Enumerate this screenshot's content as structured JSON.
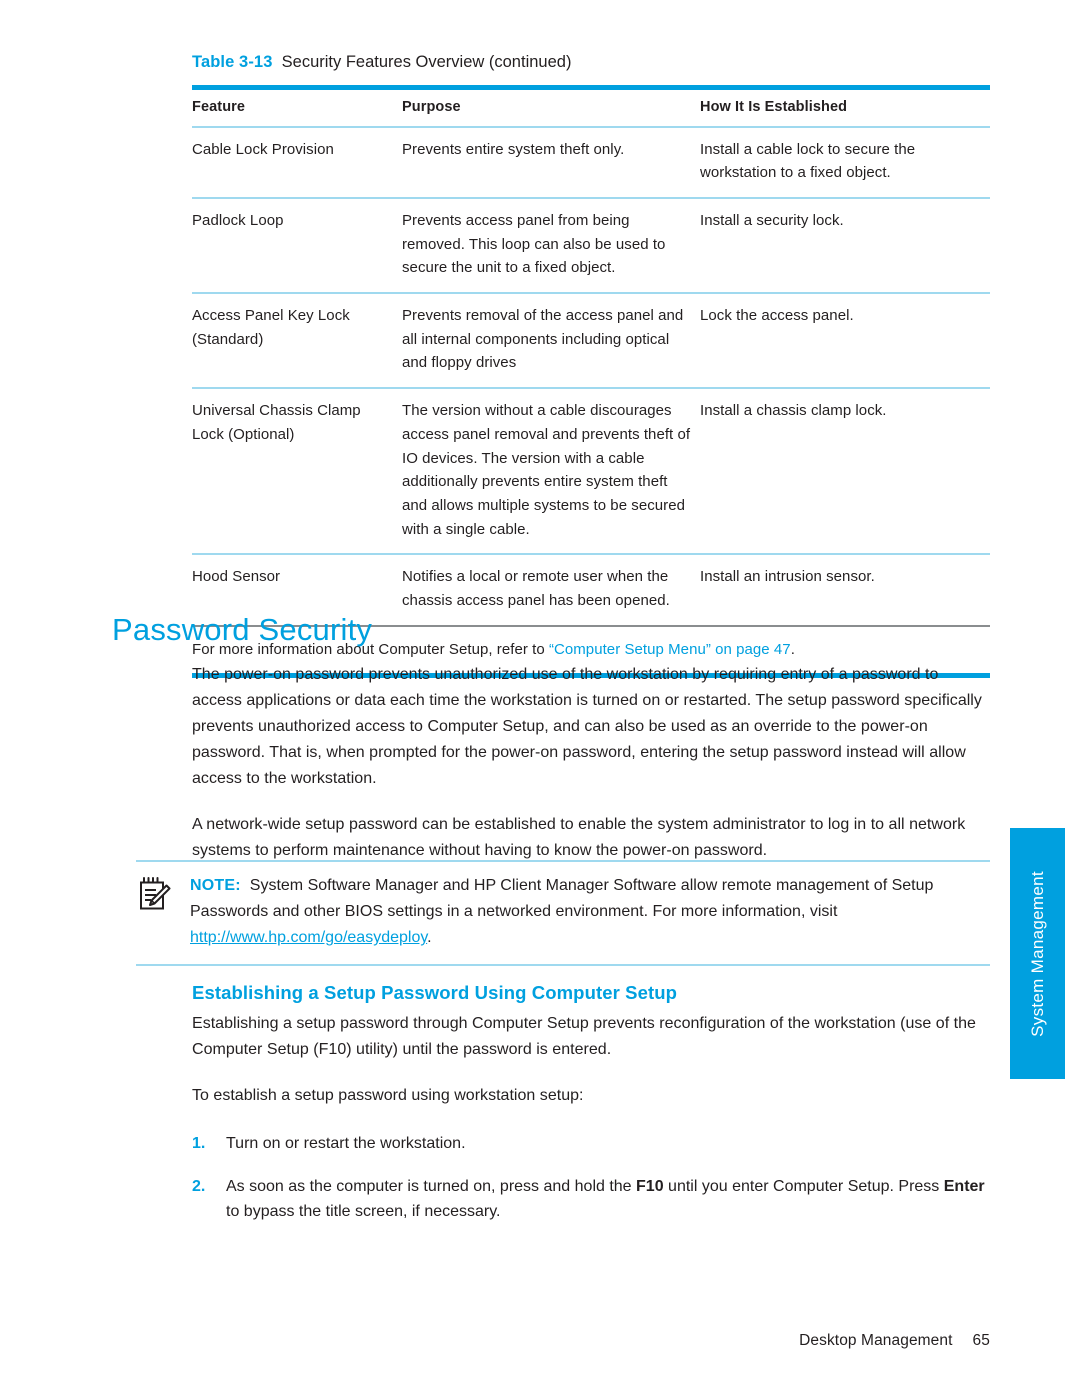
{
  "table": {
    "caption_number": "Table 3-13",
    "caption_text": "Security Features Overview (continued)",
    "headers": [
      "Feature",
      "Purpose",
      "How It Is Established"
    ],
    "rows": [
      {
        "feature": "Cable Lock Provision",
        "purpose": "Prevents entire system theft only.",
        "established": "Install a cable lock to secure the workstation to a fixed object."
      },
      {
        "feature": "Padlock Loop",
        "purpose": "Prevents access panel from being removed. This loop can also be used to secure the unit to a fixed object.",
        "established": "Install a security lock."
      },
      {
        "feature": "Access Panel Key Lock (Standard)",
        "purpose": "Prevents removal of the access panel and all internal components including optical and floppy drives",
        "established": "Lock the access panel."
      },
      {
        "feature": "Universal Chassis Clamp Lock (Optional)",
        "purpose": "The version without a cable discourages access panel removal and prevents theft of IO devices. The version with a cable additionally prevents entire system theft and allows multiple systems to be secured with a single cable.",
        "established": "Install a chassis clamp lock."
      },
      {
        "feature": "Hood Sensor",
        "purpose": "Notifies a local or remote user when the chassis access panel has been opened.",
        "established": "Install an intrusion sensor."
      }
    ],
    "footnote": {
      "lead": "For more information about Computer Setup, refer to ",
      "link": "“Computer Setup Menu” on page 47",
      "tail": "."
    }
  },
  "section": {
    "title": "Password Security",
    "paragraph_1": "The power-on password prevents unauthorized use of the workstation by requiring entry of a password to access applications or data each time the workstation is turned on or restarted. The setup password specifically prevents unauthorized access to Computer Setup, and can also be used as an override to the power-on password. That is, when prompted for the power-on password, entering the setup password instead will allow access to the workstation.",
    "paragraph_2": "A network-wide setup password can be established to enable the system administrator to log in to all network systems to perform maintenance without having to know the power-on password."
  },
  "note": {
    "icon": "note-pencil-icon",
    "label": "NOTE:",
    "text_before_url": "System Software Manager and HP Client Manager Software allow remote management of Setup Passwords and other BIOS settings in a networked environment. For more information, visit ",
    "url": "http://www.hp.com/go/easydeploy",
    "text_after_url": "."
  },
  "subsection": {
    "title": "Establishing a Setup Password Using Computer Setup",
    "paragraph_1": "Establishing a setup password through Computer Setup prevents reconfiguration of the workstation (use of the Computer Setup (F10) utility) until the password is entered.",
    "paragraph_2": "To establish a setup password using workstation setup:",
    "steps": [
      {
        "number": "1.",
        "parts": [
          {
            "text": "Turn on or restart the workstation.",
            "bold": false
          }
        ]
      },
      {
        "number": "2.",
        "parts": [
          {
            "text": "As soon as the computer is turned on, press and hold the ",
            "bold": false
          },
          {
            "text": "F10",
            "bold": true
          },
          {
            "text": " until you enter Computer Setup. Press ",
            "bold": false
          },
          {
            "text": "Enter",
            "bold": true
          },
          {
            "text": " to bypass the title screen, if necessary.",
            "bold": false
          }
        ]
      }
    ]
  },
  "side_tab": {
    "label": "System Management"
  },
  "footer": {
    "chapter": "Desktop Management",
    "page_number": "65"
  },
  "colors": {
    "accent": "#00A0DF",
    "rule_light": "#9FD9EF",
    "rule_gray": "#8A8D8F",
    "text": "#231F20"
  }
}
